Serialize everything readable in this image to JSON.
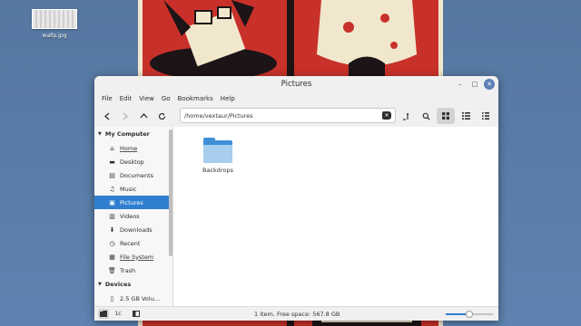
{
  "desktop": {
    "icon_label": "wallp.jpg"
  },
  "window": {
    "title": "Pictures",
    "controls": {
      "minimize": "–",
      "maximize": "□",
      "close": "✕"
    }
  },
  "menubar": [
    "File",
    "Edit",
    "View",
    "Go",
    "Bookmarks",
    "Help"
  ],
  "toolbar": {
    "location": "/home/vextaur/Pictures",
    "icons": [
      "back-icon",
      "forward-icon",
      "up-icon",
      "reload-icon",
      "terminal-icon",
      "search-icon",
      "icon-view-icon",
      "list-view-icon",
      "compact-view-icon"
    ]
  },
  "sidebar": {
    "my_computer": "My Computer",
    "items": [
      {
        "label": "Home",
        "icon": "⌂"
      },
      {
        "label": "Desktop",
        "icon": "▬"
      },
      {
        "label": "Documents",
        "icon": "▤"
      },
      {
        "label": "Music",
        "icon": "♫"
      },
      {
        "label": "Pictures",
        "icon": "▣"
      },
      {
        "label": "Videos",
        "icon": "▥"
      },
      {
        "label": "Downloads",
        "icon": "⬇"
      },
      {
        "label": "Recent",
        "icon": "◷"
      },
      {
        "label": "File System",
        "icon": "▦"
      },
      {
        "label": "Trash",
        "icon": "🗑"
      }
    ],
    "devices": "Devices",
    "volume": "2.5 GB Volu..."
  },
  "content": {
    "files": [
      {
        "name": "Backdrops",
        "type": "folder"
      }
    ]
  },
  "status": {
    "text": "1 item, Free space: 567.8 GB",
    "btn2": "1c",
    "zoom": 0.5
  },
  "colors": {
    "accent": "#2f7fd1",
    "folder": "#3f8fd6",
    "wallpaper_red": "#c8312a",
    "desktop_blue": "#5a7ea8"
  }
}
